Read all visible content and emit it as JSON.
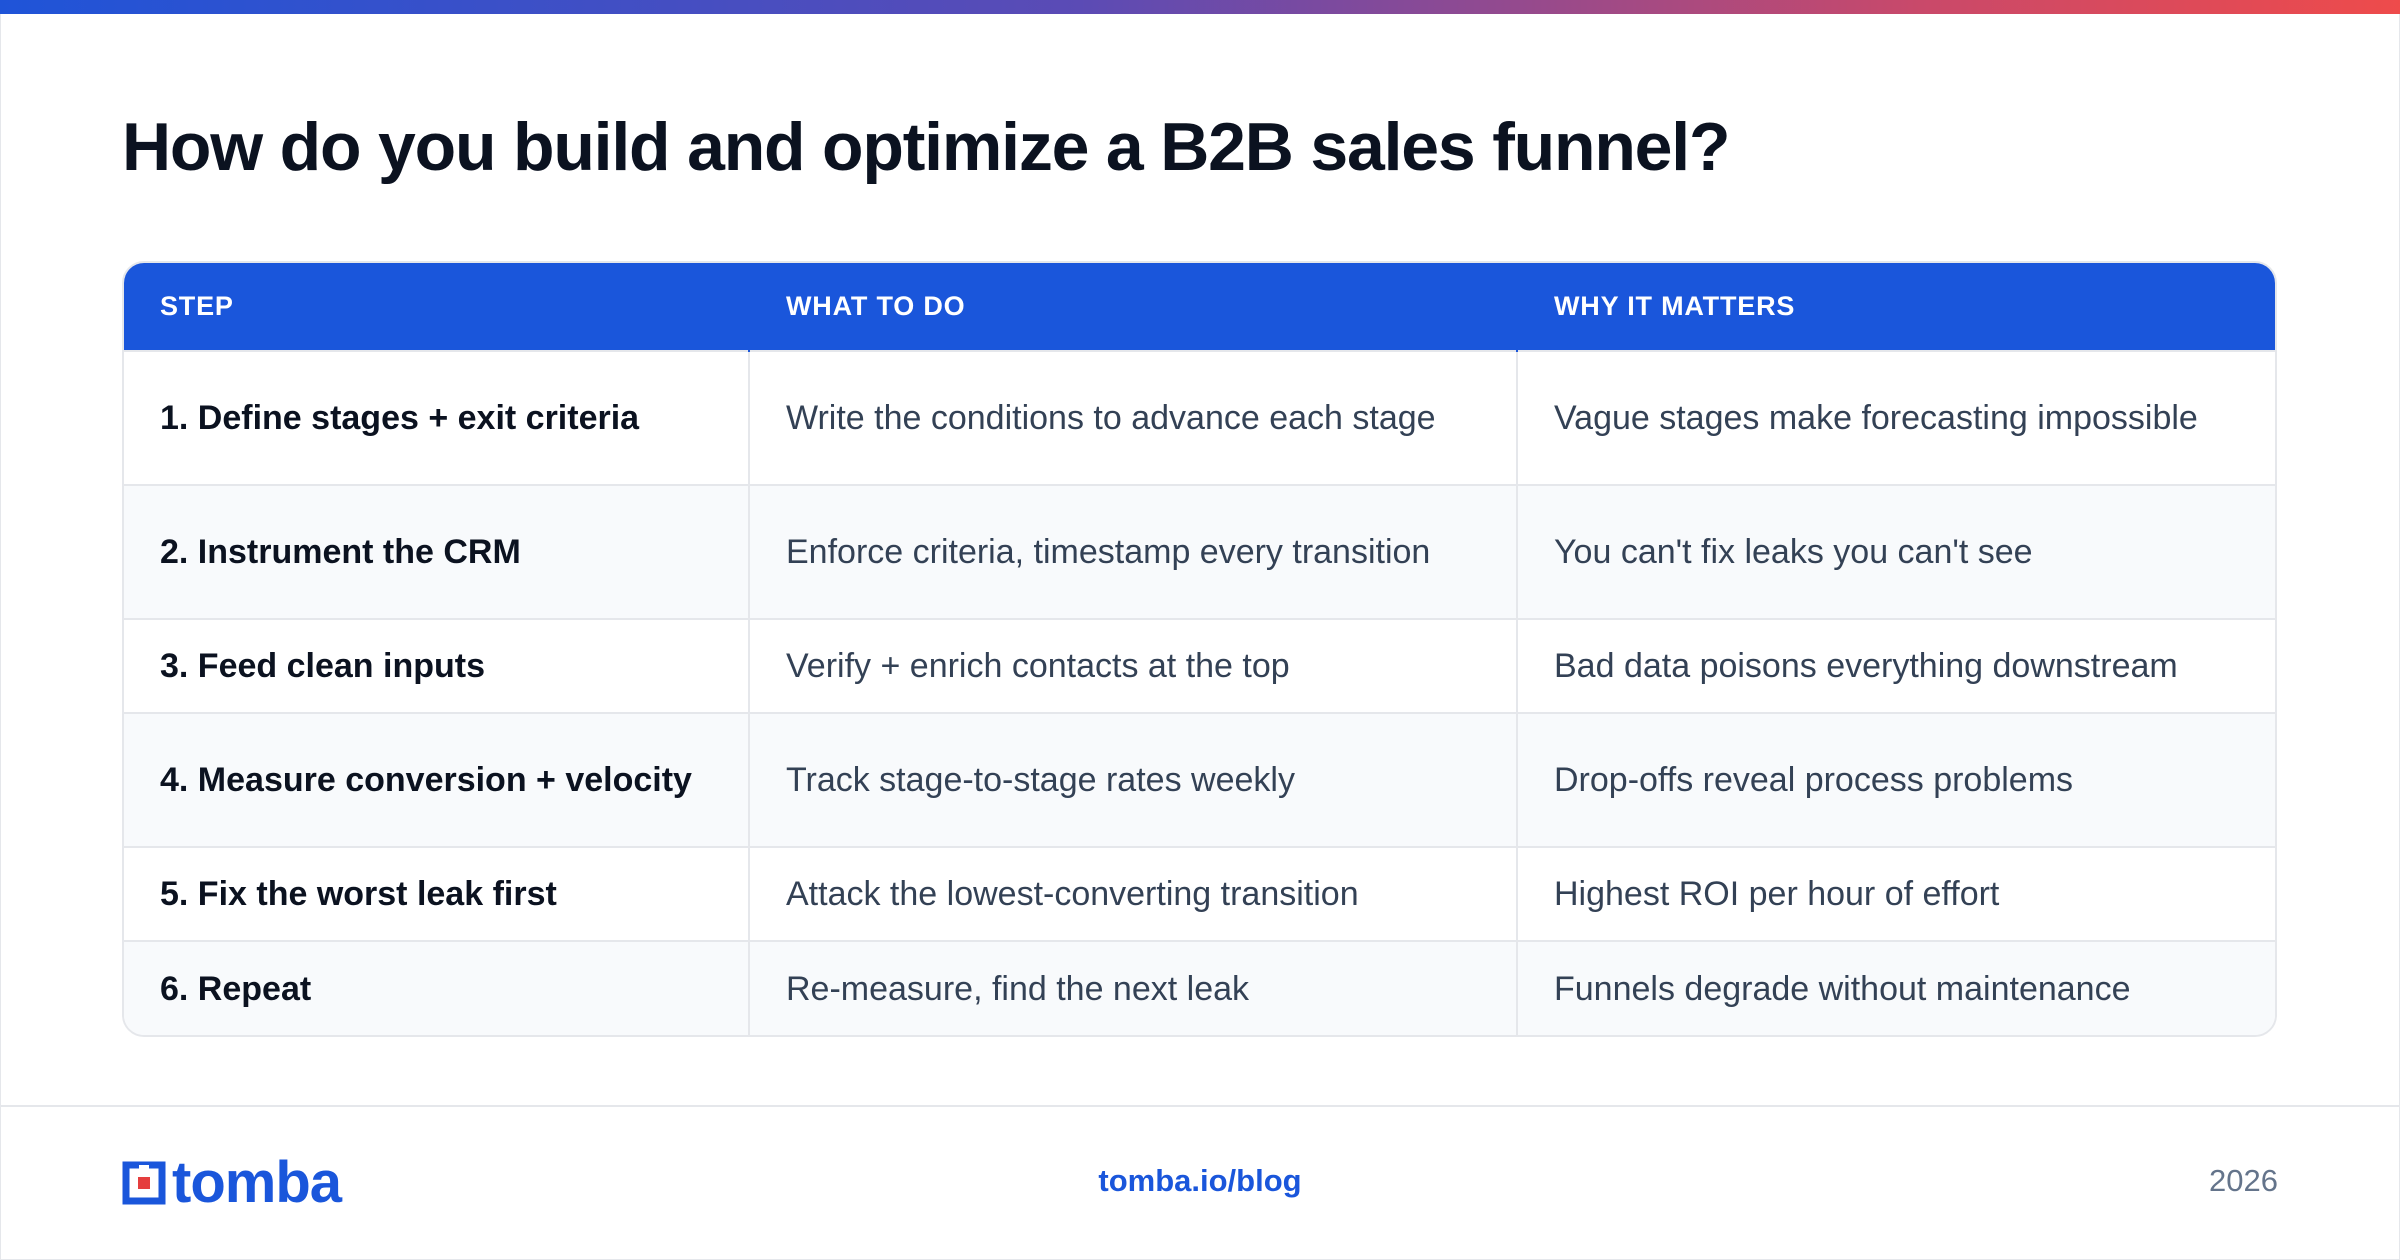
{
  "title": "How do you build and optimize a B2B sales funnel?",
  "table": {
    "headers": [
      "STEP",
      "WHAT TO DO",
      "WHY IT MATTERS"
    ],
    "rows": [
      {
        "step": "1. Define stages + exit criteria",
        "what": "Write the conditions to advance each stage",
        "why": "Vague stages make forecasting impossible"
      },
      {
        "step": "2. Instrument the CRM",
        "what": "Enforce criteria, timestamp every transition",
        "why": "You can't fix leaks you can't see"
      },
      {
        "step": "3. Feed clean inputs",
        "what": "Verify + enrich contacts at the top",
        "why": "Bad data poisons everything downstream"
      },
      {
        "step": "4. Measure conversion + velocity",
        "what": "Track stage-to-stage rates weekly",
        "why": "Drop-offs reveal process problems"
      },
      {
        "step": "5. Fix the worst leak first",
        "what": "Attack the lowest-converting transition",
        "why": "Highest ROI per hour of effort"
      },
      {
        "step": "6. Repeat",
        "what": "Re-measure, find the next leak",
        "why": "Funnels degrade without maintenance"
      }
    ]
  },
  "footer": {
    "logo_text": "tomba",
    "site": "tomba.io/blog",
    "year": "2026"
  },
  "colors": {
    "accent": "#1a56db",
    "gradient_start": "#1f54d8",
    "gradient_end": "#ee4b4b",
    "logo_red": "#e53e3e"
  }
}
